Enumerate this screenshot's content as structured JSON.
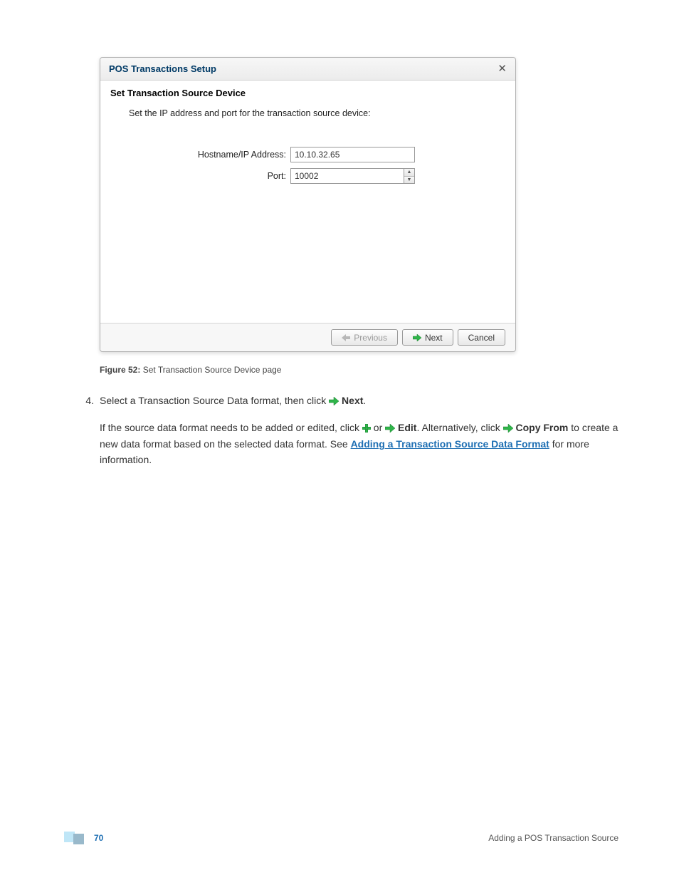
{
  "dialog": {
    "title": "POS Transactions Setup",
    "subtitle": "Set Transaction Source Device",
    "instruction": "Set the IP address and port for the transaction source device:",
    "hostname_label": "Hostname/IP Address:",
    "hostname_value": "10.10.32.65",
    "port_label": "Port:",
    "port_value": "10002",
    "previous": "Previous",
    "next": "Next",
    "cancel": "Cancel"
  },
  "figure": {
    "label": "Figure 52:",
    "caption": "Set Transaction Source Device page"
  },
  "step": {
    "num": "4.",
    "before_icon": "Select a Transaction Source Data format, then click",
    "bold1": "Next",
    "after_bold1": "."
  },
  "para": {
    "t1": "If the source data format needs to be added or edited, click",
    "or": "or",
    "edit": "Edit",
    "alt": ". Alternatively, click",
    "copy": "Copy From",
    "t2": " to create a new data format based on the selected data format. See ",
    "link": "Adding a Transaction Source Data Format",
    "t3": " for more information."
  },
  "footer": {
    "page": "70",
    "section": "Adding a POS Transaction Source"
  }
}
